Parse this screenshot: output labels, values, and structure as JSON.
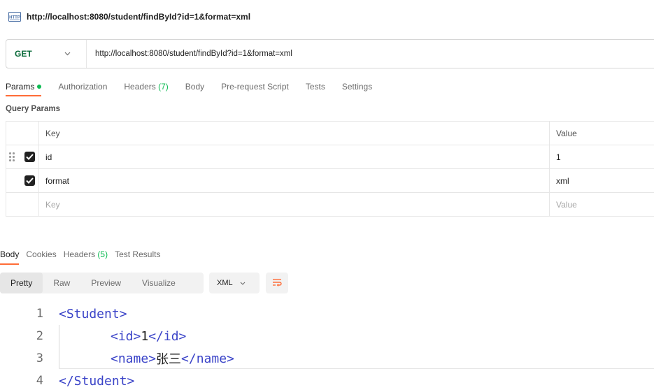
{
  "tab_title": "http://localhost:8080/student/findById?id=1&format=xml",
  "request": {
    "method": "GET",
    "url": "http://localhost:8080/student/findById?id=1&format=xml"
  },
  "request_tabs": [
    {
      "label": "Params",
      "active": true
    },
    {
      "label": "Authorization"
    },
    {
      "label": "Headers",
      "count": "(7)"
    },
    {
      "label": "Body"
    },
    {
      "label": "Pre-request Script"
    },
    {
      "label": "Tests"
    },
    {
      "label": "Settings"
    }
  ],
  "query_params": {
    "title": "Query Params",
    "header": {
      "key": "Key",
      "value": "Value"
    },
    "rows": [
      {
        "key": "id",
        "value": "1",
        "checked": true
      },
      {
        "key": "format",
        "value": "xml",
        "checked": true
      }
    ],
    "placeholder": {
      "key": "Key",
      "value": "Value"
    }
  },
  "response_tabs": [
    {
      "label": "Body",
      "active": true
    },
    {
      "label": "Cookies"
    },
    {
      "label": "Headers",
      "count": "(5)"
    },
    {
      "label": "Test Results"
    }
  ],
  "view_modes": [
    "Pretty",
    "Raw",
    "Preview",
    "Visualize"
  ],
  "active_view": "Pretty",
  "format": "XML",
  "code_lines": [
    {
      "num": "1",
      "open": "<Student>"
    },
    {
      "num": "2",
      "open": "<id>",
      "text": "1",
      "close": "</id>"
    },
    {
      "num": "3",
      "open": "<name>",
      "text": "张三",
      "close": "</name>"
    },
    {
      "num": "4",
      "open": "</Student>"
    }
  ],
  "colors": {
    "accent": "#ff6c37",
    "success": "#0cbb52",
    "method": "#0b6b3a",
    "xml_tag": "#3b44c8"
  },
  "icons": [
    "http-icon",
    "chevron-down-icon",
    "drag-handle-icon",
    "checkbox-checked-icon",
    "wrap-lines-icon"
  ]
}
